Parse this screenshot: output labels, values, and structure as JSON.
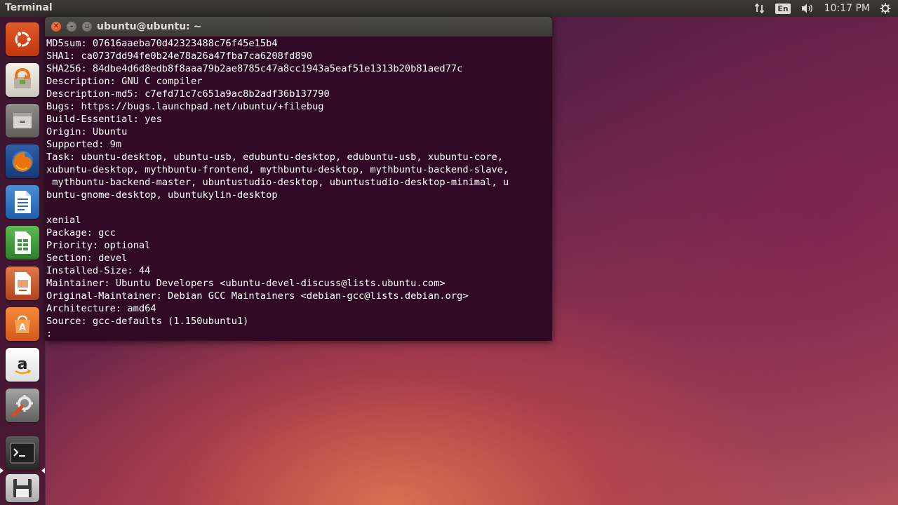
{
  "top_panel": {
    "app_title": "Terminal",
    "keyboard_layout": "En",
    "time": "10:17 PM"
  },
  "launcher": {
    "items": [
      {
        "name": "dash-home-icon",
        "color": "#dd4814"
      },
      {
        "name": "software-updater-icon",
        "color": "#e8e4dc"
      },
      {
        "name": "files-icon",
        "color": "#8b8a86"
      },
      {
        "name": "firefox-icon",
        "color": "#e86b10"
      },
      {
        "name": "libreoffice-writer-icon",
        "color": "#2a6fbb"
      },
      {
        "name": "libreoffice-calc-icon",
        "color": "#3e9a3c"
      },
      {
        "name": "libreoffice-impress-icon",
        "color": "#c8542b"
      },
      {
        "name": "ubuntu-software-center-icon",
        "color": "#e86a1e"
      },
      {
        "name": "amazon-icon",
        "color": "#f2f2f2"
      },
      {
        "name": "system-settings-icon",
        "color": "#7a7a7a"
      },
      {
        "name": "terminal-icon",
        "color": "#2c2c2c"
      },
      {
        "name": "floppy-disk-icon",
        "color": "#c9c9c9"
      }
    ]
  },
  "terminal": {
    "title": "ubuntu@ubuntu: ~",
    "lines": [
      "MD5sum: 07616aaeba70d42323488c76f45e15b4",
      "SHA1: ca0737dd94fe0b24e78a26a47fba7ca6208fd890",
      "SHA256: 84dbe4d6d8edb8f8aaa79b2ae8785c47a8cc1943a5eaf51e1313b20b81aed77c",
      "Description: GNU C compiler",
      "Description-md5: c7efd71c7c651a9ac8b2adf36b137790",
      "Bugs: https://bugs.launchpad.net/ubuntu/+filebug",
      "Build-Essential: yes",
      "Origin: Ubuntu",
      "Supported: 9m",
      "Task: ubuntu-desktop, ubuntu-usb, edubuntu-desktop, edubuntu-usb, xubuntu-core,",
      "xubuntu-desktop, mythbuntu-frontend, mythbuntu-desktop, mythbuntu-backend-slave,",
      " mythbuntu-backend-master, ubuntustudio-desktop, ubuntustudio-desktop-minimal, u",
      "buntu-gnome-desktop, ubuntukylin-desktop",
      "",
      "xenial",
      "Package: gcc",
      "Priority: optional",
      "Section: devel",
      "Installed-Size: 44",
      "Maintainer: Ubuntu Developers <ubuntu-devel-discuss@lists.ubuntu.com>",
      "Original-Maintainer: Debian GCC Maintainers <debian-gcc@lists.debian.org>",
      "Architecture: amd64",
      "Source: gcc-defaults (1.150ubuntu1)",
      ":"
    ]
  }
}
